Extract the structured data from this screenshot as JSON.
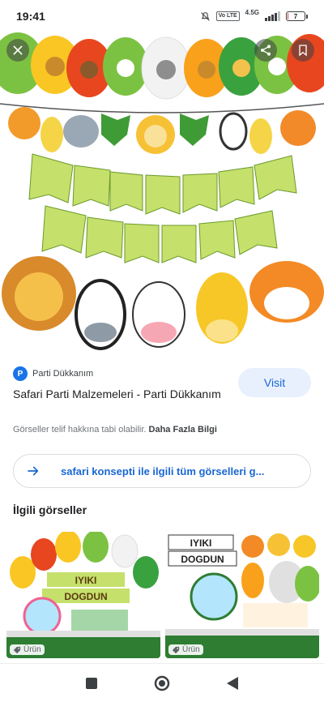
{
  "status_bar": {
    "time": "19:41",
    "volte_label": "Vo LTE",
    "network": "4.5G",
    "battery_percent": "7",
    "battery_level": 0.07,
    "icons": [
      "mute-icon",
      "volte-icon",
      "signal-icon",
      "battery-icon"
    ]
  },
  "viewer": {
    "buttons": [
      "close-icon",
      "share-icon",
      "bookmark-icon"
    ]
  },
  "result": {
    "source_name": "Parti Dükkanım",
    "favicon_letter": "P",
    "visit_label": "Visit",
    "title": "Safari Parti Malzemeleri - Parti Dükkanım",
    "copyright_text": "Görseller telif hakkına tabi olabilir.",
    "more_info_label": "Daha Fazla Bilgi"
  },
  "all_images": {
    "label": "safari konsepti ile ilgili tüm görselleri g..."
  },
  "related": {
    "heading": "İlgili görseller",
    "items": [
      {
        "badge": "Ürün"
      },
      {
        "badge": "Ürün"
      }
    ]
  },
  "thumb_text": {
    "thumb1_line1": "IYIKI",
    "thumb1_line2": "DOGDUN",
    "thumb2_line1": "IYIKI",
    "thumb2_line2": "DOGDUN"
  },
  "colors": {
    "accent": "#1a73e8",
    "visit_bg": "#e8f0fe",
    "link": "#1967d2",
    "battery_low": "#e53935"
  },
  "nav": {
    "icons": [
      "recents-square-icon",
      "home-circle-icon",
      "back-triangle-icon"
    ]
  }
}
